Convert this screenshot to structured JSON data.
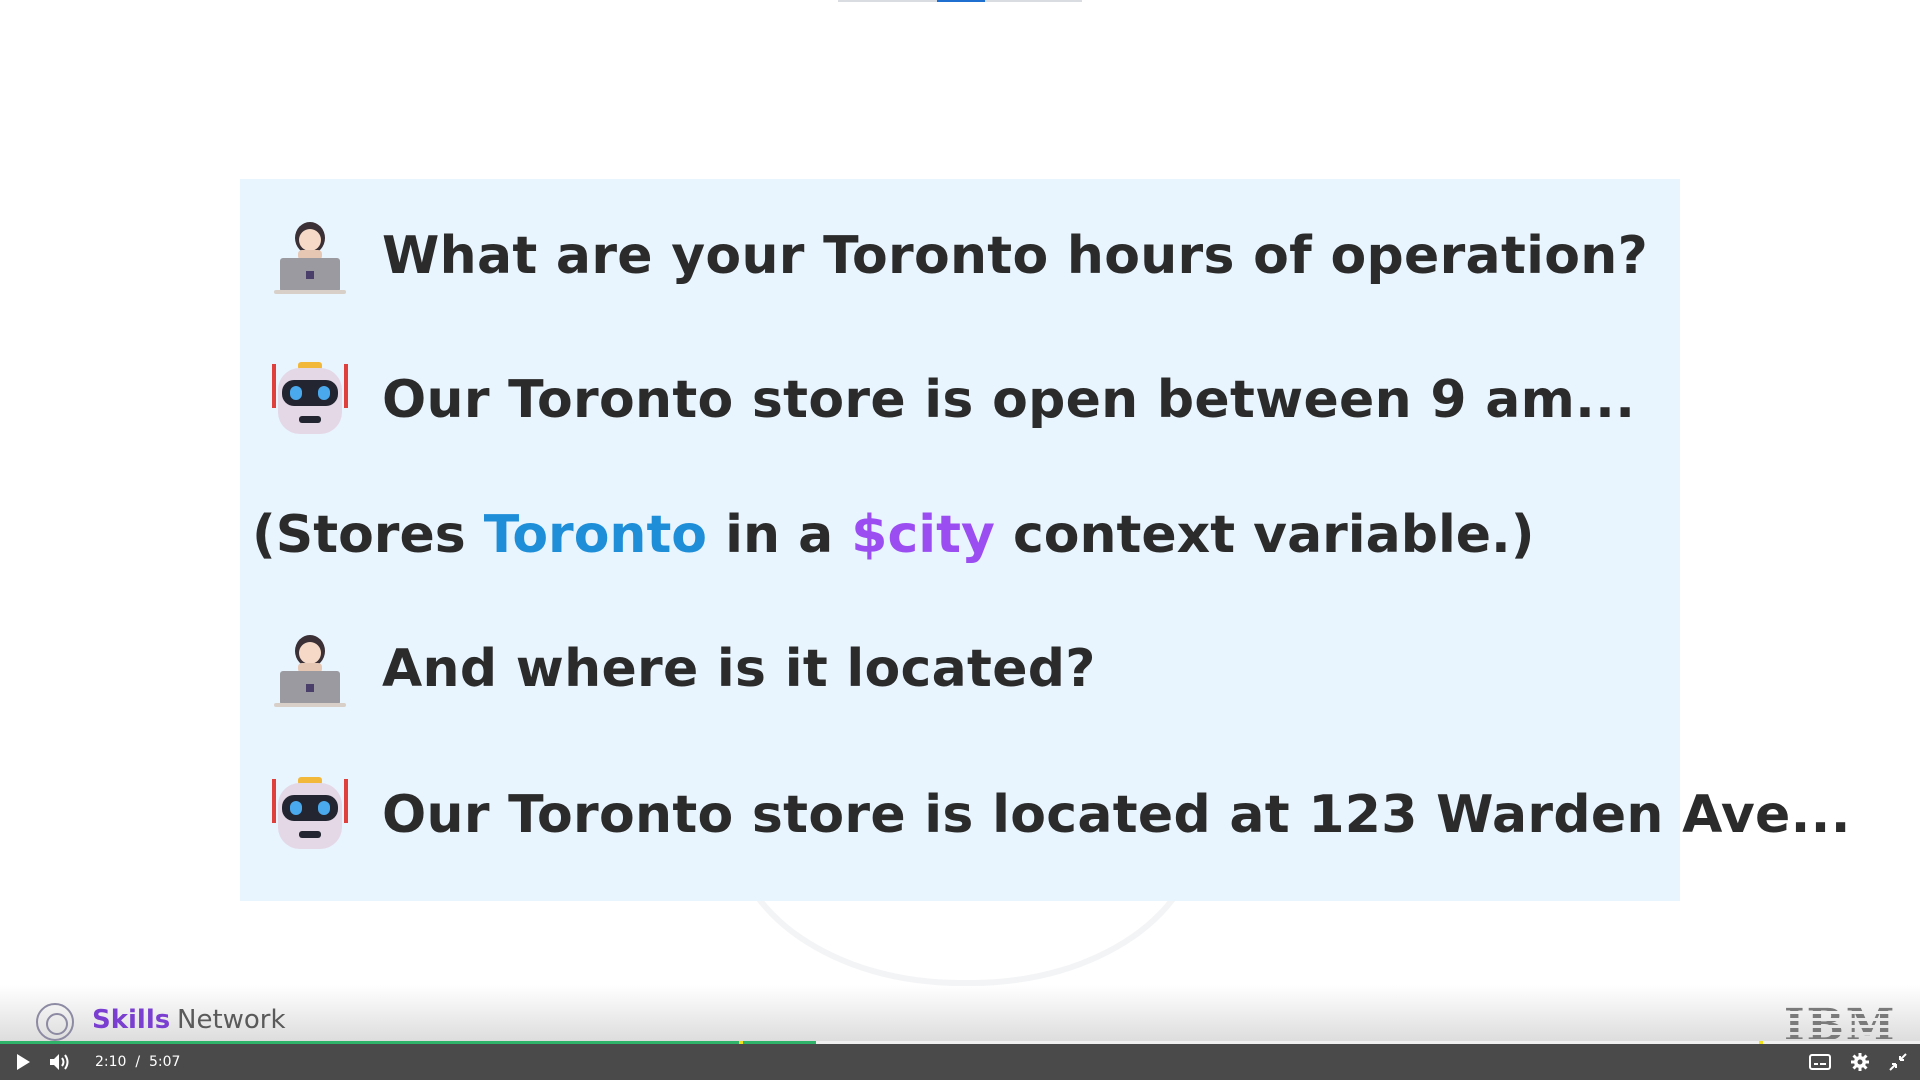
{
  "slide": {
    "messages": [
      {
        "speaker": "user",
        "icon": "user-laptop-icon",
        "text": "What are your Toronto hours of operation?"
      },
      {
        "speaker": "bot",
        "icon": "robot-icon",
        "text": "Our Toronto store is open between 9 am..."
      },
      {
        "speaker": "user",
        "icon": "user-laptop-icon",
        "text": "And where is it located?"
      },
      {
        "speaker": "bot",
        "icon": "robot-icon",
        "text": "Our Toronto store is located at 123 Warden Ave..."
      }
    ],
    "note": {
      "prefix": "(Stores ",
      "city": "Toronto",
      "middle": " in a ",
      "variable": "$city",
      "suffix": " context variable.)"
    },
    "colors": {
      "panel": "#e8f4fe",
      "city": "#1f8ed8",
      "variable": "#9b4df2"
    }
  },
  "branding": {
    "skills": "Skills",
    "network": "Network",
    "ibm": "IBM"
  },
  "player": {
    "current_time": "2:10",
    "separator": "/",
    "duration": "5:07",
    "progress_fraction": 0.425,
    "icons": {
      "play": "play-icon",
      "volume": "volume-icon",
      "captions": "captions-icon",
      "settings": "settings-gear-icon",
      "fullscreen": "exit-fullscreen-icon"
    },
    "colors": {
      "bar": "#4a4a4a",
      "progress": "#2fb26a",
      "marker": "#f2e21c"
    }
  }
}
